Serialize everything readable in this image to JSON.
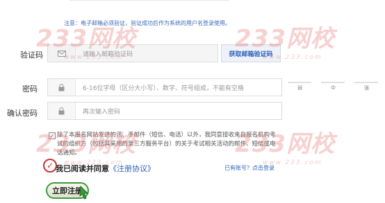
{
  "notice": "注意：电子邮箱必须验证，验证成功后作为系统的用户名登录使用。",
  "fields": {
    "code": {
      "label": "验证码",
      "placeholder": "请输入邮箱验证码",
      "button": "获取邮箱验证码"
    },
    "password": {
      "label": "密码",
      "placeholder": "6-16位字母（区分大小写）、数字、符号组成，不能有空格"
    },
    "confirm": {
      "label": "确认密码",
      "placeholder": "再次输入密码"
    }
  },
  "strength": [
    "弱",
    "中",
    "强"
  ],
  "agreement": {
    "text": "除了本报名网站发送的讯、手邮件（短信、电话）以外，我同意接收来自报名机构考试的组织方（包括其采用的第三方服务平台）的关于考试相关活动的邮件、短信或电话通知。",
    "read_prefix": "我已阅读并同意",
    "read_link": "《注册协议》"
  },
  "login_link": "已有账号？点击登录",
  "register_button": "立即注册",
  "watermark": {
    "main": "233网校",
    "sub": "www.233.com"
  },
  "colors": {
    "link": "#2c62b8",
    "accent_red": "#c83232",
    "button_border": "#3c9a3c"
  }
}
